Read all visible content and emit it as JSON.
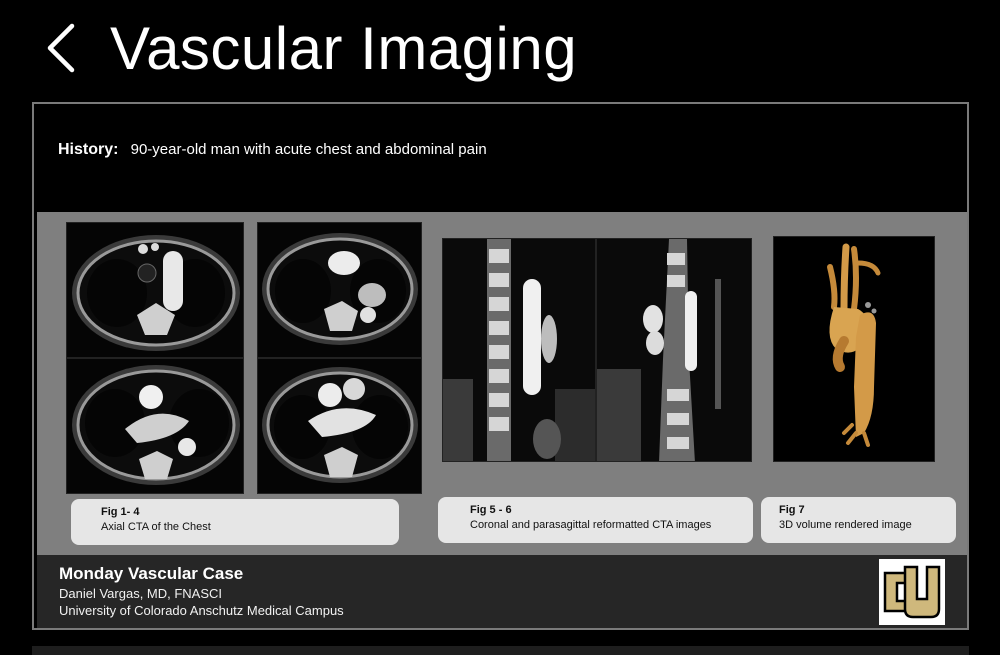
{
  "header": {
    "title": "Vascular Imaging",
    "back_icon": "chevron-left-icon"
  },
  "history": {
    "label": "History:",
    "text": "90-year-old man with acute chest and abdominal pain"
  },
  "captions": [
    {
      "fig": "Fig 1- 4",
      "text": "Axial CTA of the Chest"
    },
    {
      "fig": "Fig 5 - 6",
      "text": "Coronal and parasagittal reformatted CTA images"
    },
    {
      "fig": "Fig 7",
      "text": "3D volume rendered image"
    }
  ],
  "footer": {
    "title": "Monday Vascular Case",
    "author": "Daniel Vargas, MD, FNASCI",
    "institution": "University of Colorado Anschutz Medical Campus",
    "logo_icon": "cu-logo-icon"
  },
  "colors": {
    "background": "#000000",
    "panel": "#7f7f7f",
    "caption_bg": "#e6e6e6",
    "footer_bg": "#262626",
    "logo_gold": "#cfb87c"
  }
}
